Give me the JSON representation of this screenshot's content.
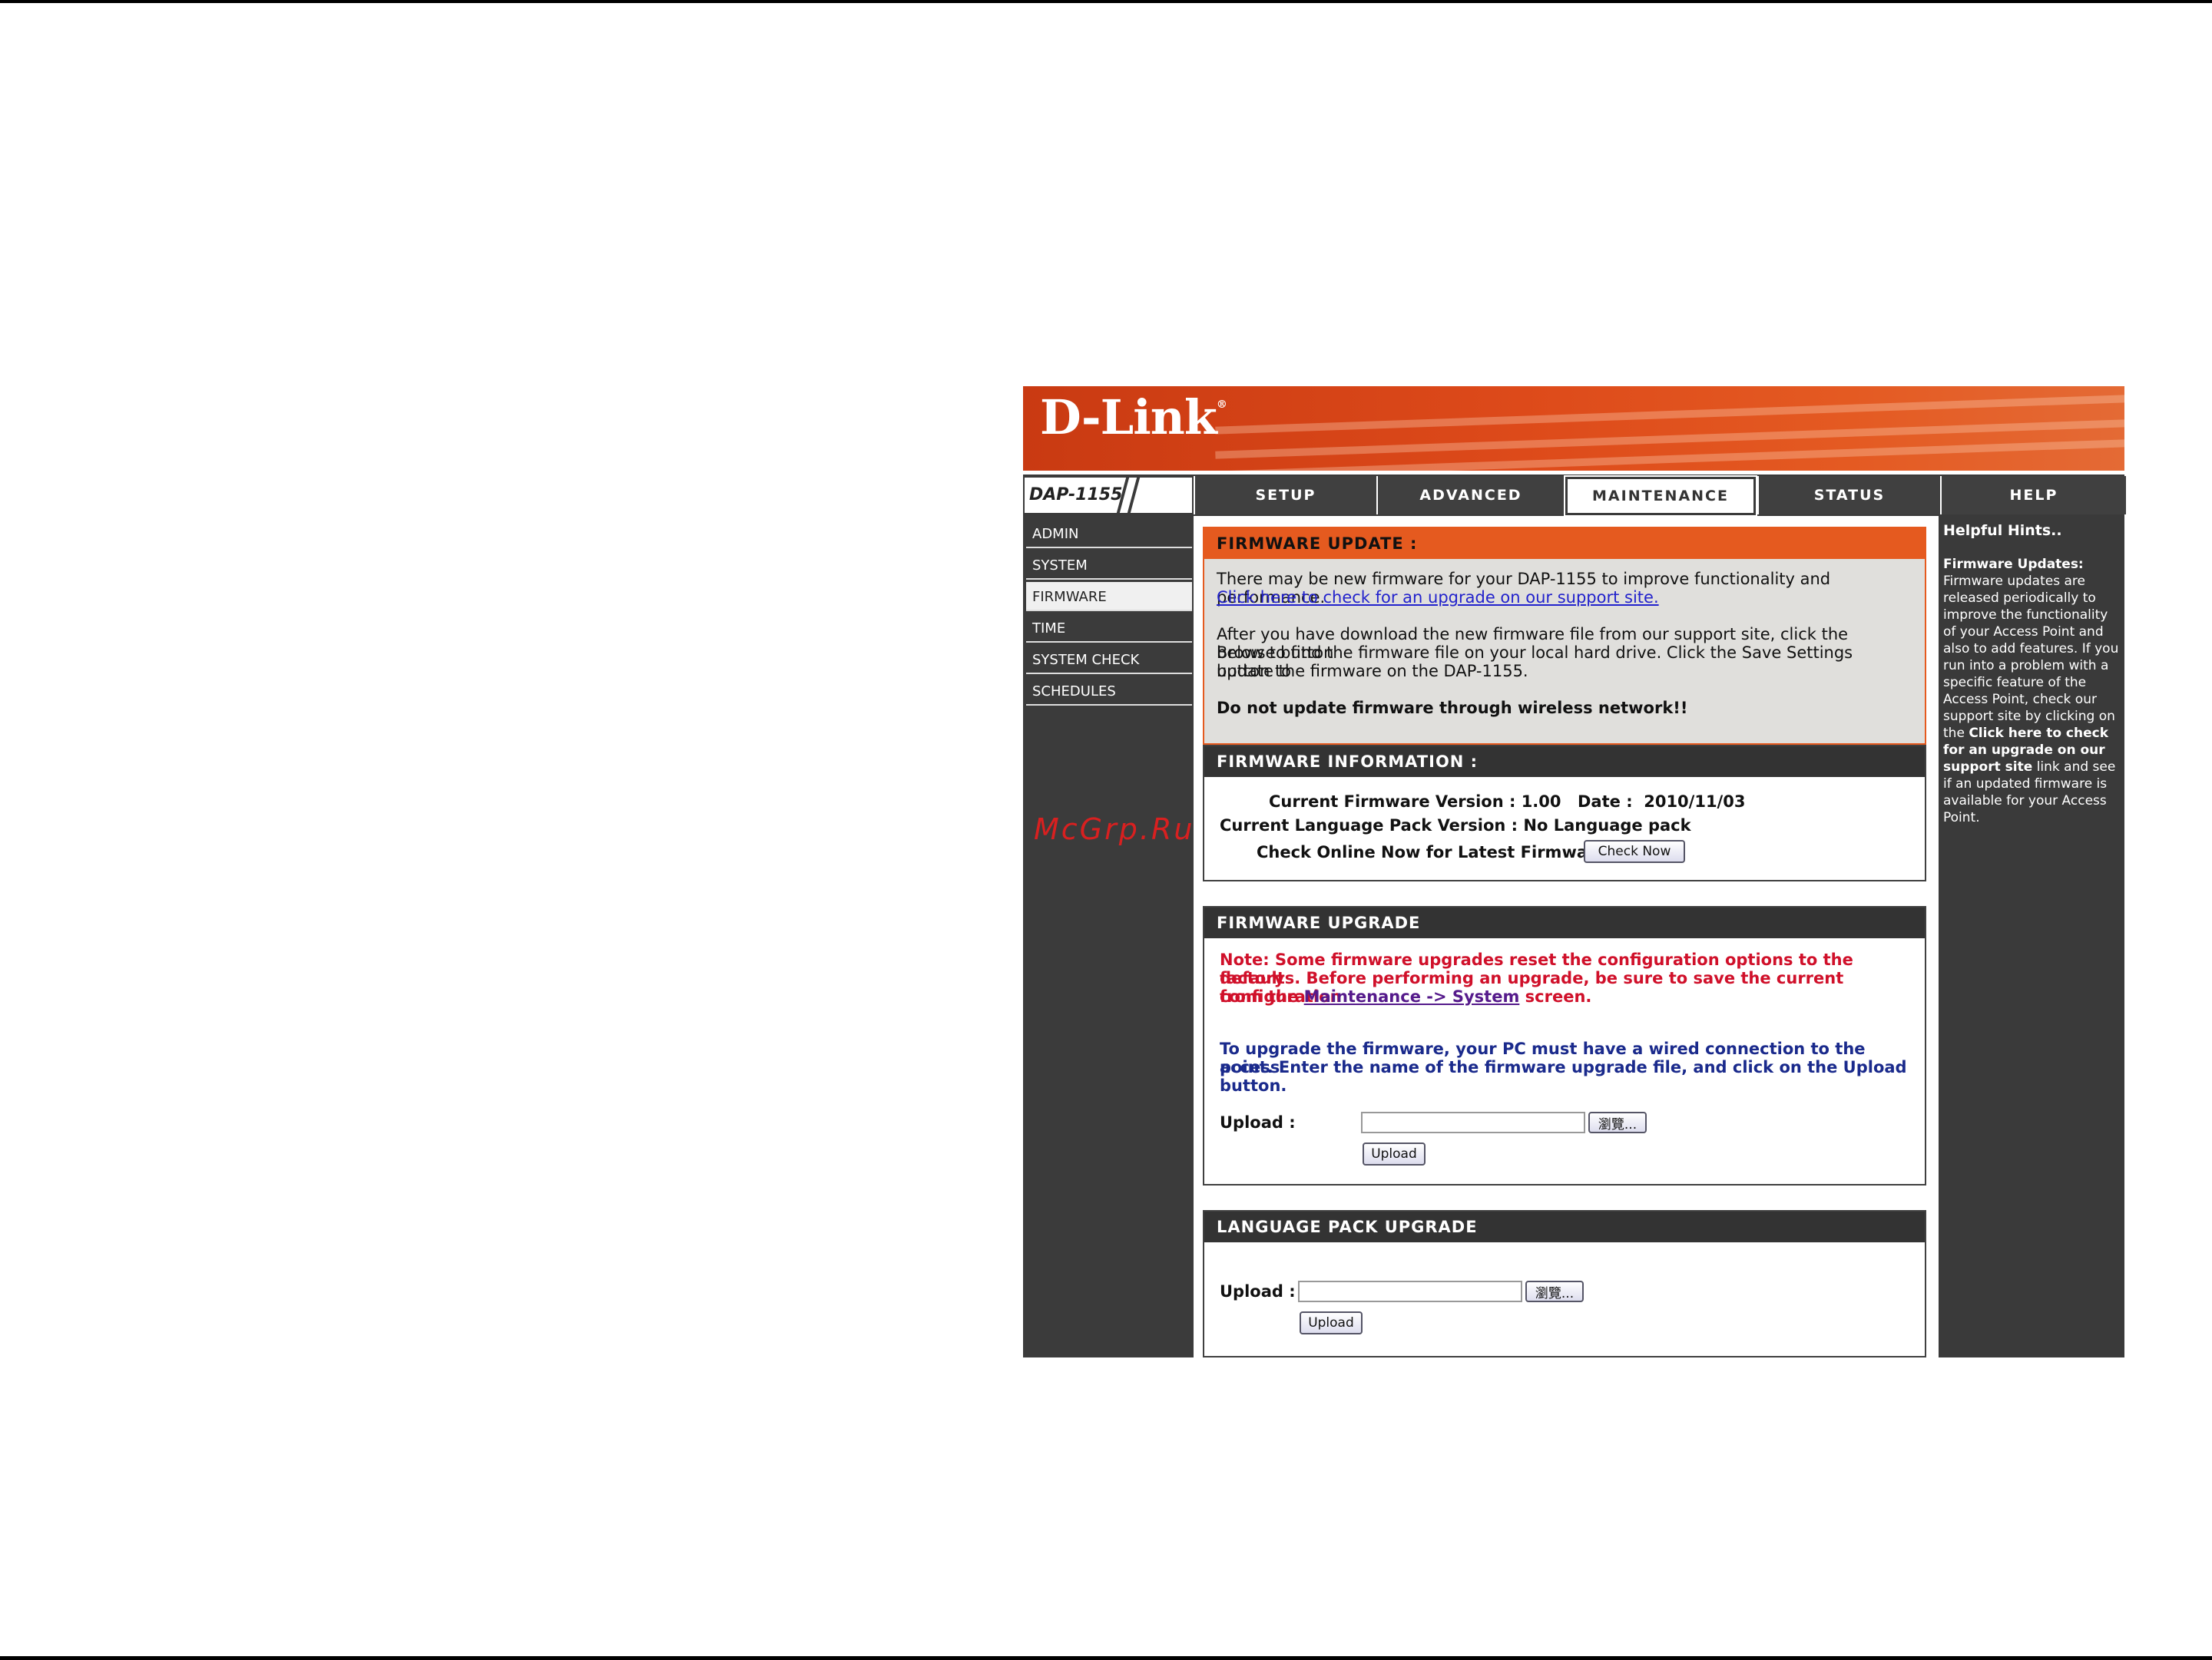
{
  "brand": {
    "logo": "D-Link",
    "trademark": "®",
    "model": "DAP-1155"
  },
  "tabs": [
    {
      "label": "SETUP"
    },
    {
      "label": "ADVANCED"
    },
    {
      "label": "MAINTENANCE",
      "active": true
    },
    {
      "label": "STATUS"
    },
    {
      "label": "HELP"
    }
  ],
  "sidebar": {
    "items": [
      {
        "label": "ADMIN"
      },
      {
        "label": "SYSTEM"
      },
      {
        "label": "FIRMWARE",
        "active": true
      },
      {
        "label": "TIME"
      },
      {
        "label": "SYSTEM CHECK"
      },
      {
        "label": "SCHEDULES"
      }
    ],
    "watermark": "McGrp.Ru"
  },
  "firmware_update": {
    "header": "FIRMWARE UPDATE :",
    "line1": "There may be new firmware for your DAP-1155 to improve functionality and performance.",
    "link": "Click here to check for an upgrade on our support site.",
    "para2_l1": "After you have download the new firmware file from our support site, click the Browse button",
    "para2_l2": "below to find the firmware file on your local hard drive. Click the Save Settings button to",
    "para2_l3": "update the firmware on the DAP-1155.",
    "warning": "Do not update firmware through wireless network!!"
  },
  "firmware_info": {
    "header": "FIRMWARE INFORMATION :",
    "version_label": "Current Firmware Version :",
    "version": "1.00",
    "date_label": "Date :",
    "date": "2010/11/03",
    "langpack_label": "Current Language Pack Version :",
    "langpack": "No Language pack",
    "check_label": "Check Online Now for Latest Firmware :",
    "check_button": "Check Now"
  },
  "firmware_upgrade": {
    "header": "FIRMWARE UPGRADE",
    "note_l1": "Note: Some firmware upgrades reset the configuration options to the factory",
    "note_l2": "defaults. Before performing an upgrade, be sure to save the current configuration",
    "note_l3_pre": "from the",
    "note_link": "Maintenance -> System",
    "note_l3_post": "screen.",
    "info_l1": "To upgrade the firmware, your PC must have a wired connection to the access",
    "info_l2": "point. Enter the name of the firmware upgrade file, and click on the Upload button.",
    "upload_label": "Upload :",
    "browse_button": "瀏覽...",
    "upload_button": "Upload"
  },
  "language_pack": {
    "header": "LANGUAGE PACK UPGRADE",
    "upload_label": "Upload :",
    "browse_button": "瀏覽...",
    "upload_button": "Upload"
  },
  "help": {
    "title": "Helpful Hints..",
    "heading": "Firmware Updates:",
    "text1": "Firmware updates are released periodically to improve the functionality of your Access Point and also to add features. If you run into a problem with a specific feature of the Access Point, check our support site by clicking on the",
    "bold": "Click here to check for an upgrade on our support site",
    "text2": "link and see if an updated firmware is available for your Access Point."
  }
}
